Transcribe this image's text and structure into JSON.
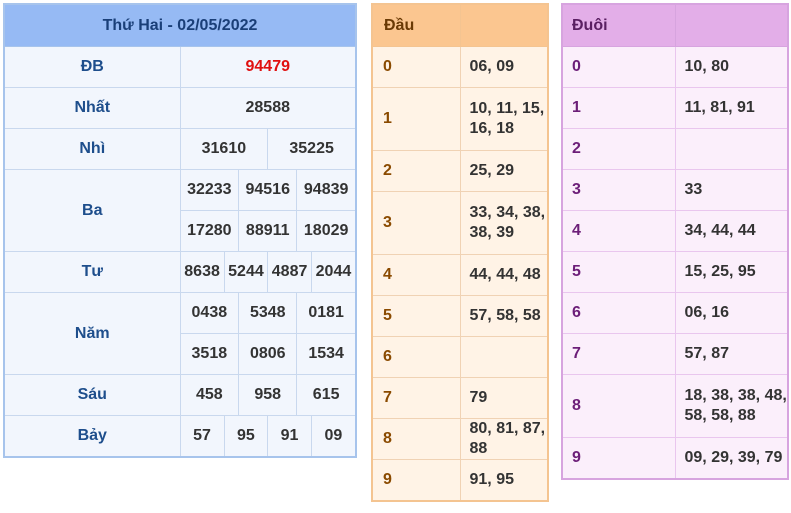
{
  "results": {
    "title": "Thứ Hai - 02/05/2022",
    "rows": {
      "db": {
        "label": "ĐB",
        "values": [
          "94479"
        ]
      },
      "nhat": {
        "label": "Nhất",
        "values": [
          "28588"
        ]
      },
      "nhi": {
        "label": "Nhì",
        "values": [
          "31610",
          "35225"
        ]
      },
      "ba": {
        "label": "Ba",
        "values": [
          "32233",
          "94516",
          "94839",
          "17280",
          "88911",
          "18029"
        ]
      },
      "tu": {
        "label": "Tư",
        "values": [
          "8638",
          "5244",
          "4887",
          "2044"
        ]
      },
      "nam": {
        "label": "Năm",
        "values": [
          "0438",
          "5348",
          "0181",
          "3518",
          "0806",
          "1534"
        ]
      },
      "sau": {
        "label": "Sáu",
        "values": [
          "458",
          "958",
          "615"
        ]
      },
      "bay": {
        "label": "Bảy",
        "values": [
          "57",
          "95",
          "91",
          "09"
        ]
      }
    }
  },
  "head": {
    "title": "Đầu",
    "rows": [
      {
        "digit": "0",
        "values": "06, 09"
      },
      {
        "digit": "1",
        "values": "10, 11, 15, 16, 18"
      },
      {
        "digit": "2",
        "values": "25, 29"
      },
      {
        "digit": "3",
        "values": "33, 34, 38, 38, 39"
      },
      {
        "digit": "4",
        "values": "44, 44, 48"
      },
      {
        "digit": "5",
        "values": "57, 58, 58"
      },
      {
        "digit": "6",
        "values": ""
      },
      {
        "digit": "7",
        "values": "79"
      },
      {
        "digit": "8",
        "values": "80, 81, 87, 88"
      },
      {
        "digit": "9",
        "values": "91, 95"
      }
    ]
  },
  "tail": {
    "title": "Đuôi",
    "rows": [
      {
        "digit": "0",
        "values": "10, 80"
      },
      {
        "digit": "1",
        "values": "11, 81, 91"
      },
      {
        "digit": "2",
        "values": ""
      },
      {
        "digit": "3",
        "values": "33"
      },
      {
        "digit": "4",
        "values": "34, 44, 44"
      },
      {
        "digit": "5",
        "values": "15, 25, 95"
      },
      {
        "digit": "6",
        "values": "06, 16"
      },
      {
        "digit": "7",
        "values": "57, 87"
      },
      {
        "digit": "8",
        "values": "18, 38, 38, 48, 58, 58, 88"
      },
      {
        "digit": "9",
        "values": "09, 29, 39, 79"
      }
    ]
  },
  "colors": {
    "results_header": "#96baf4",
    "special_prize": "#e01010",
    "head_header": "#fbc690",
    "tail_header": "#e3aee8"
  }
}
